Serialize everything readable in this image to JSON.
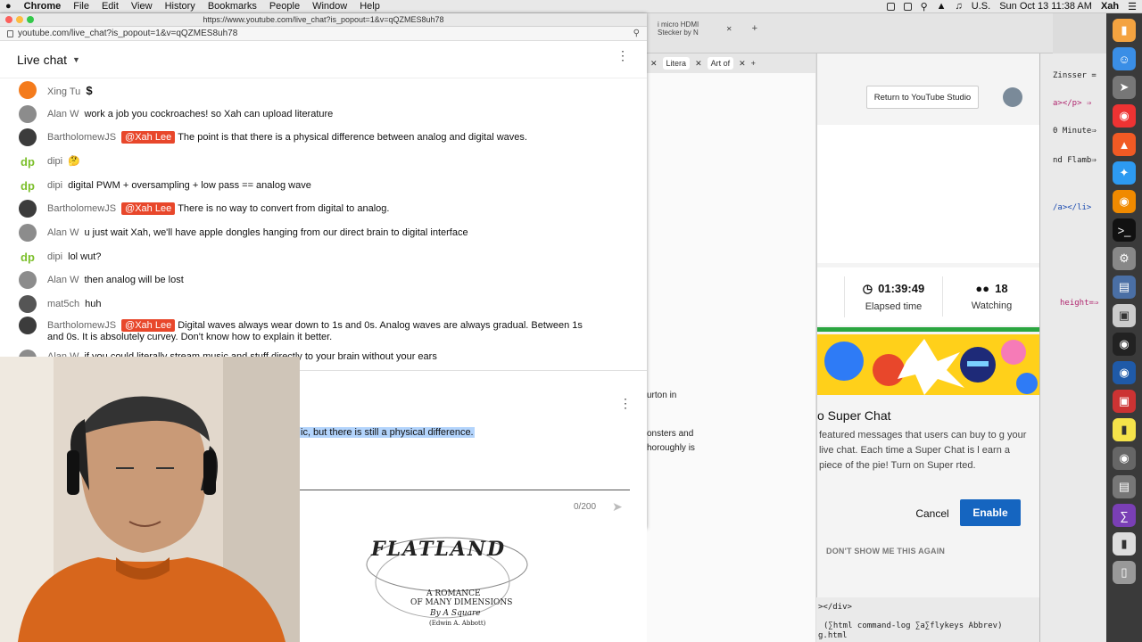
{
  "menubar": {
    "apple": "",
    "items": [
      "Chrome",
      "File",
      "Edit",
      "View",
      "History",
      "Bookmarks",
      "People",
      "Window",
      "Help"
    ],
    "right_region": "U.S.",
    "datetime": "Sun Oct 13  11:38 AM",
    "user": "Xah"
  },
  "popup": {
    "title_url": "https://www.youtube.com/live_chat?is_popout=1&v=qQZMES8uh78",
    "address": "youtube.com/live_chat?is_popout=1&v=qQZMES8uh78",
    "chat_title": "Live chat",
    "messages": [
      {
        "author": "Xing Tu",
        "mention": "",
        "text": "$"
      },
      {
        "author": "Alan W",
        "mention": "",
        "text": "work a job you cockroaches! so Xah can upload literature"
      },
      {
        "author": "BartholomewJS",
        "mention": "@Xah Lee",
        "text": "The point is that there is a physical difference between analog and digital waves."
      },
      {
        "author": "dipi",
        "mention": "",
        "text": "🤔"
      },
      {
        "author": "dipi",
        "mention": "",
        "text": "digital PWM + oversampling + low pass == analog wave"
      },
      {
        "author": "BartholomewJS",
        "mention": "@Xah Lee",
        "text": "There is no way to convert from digital to analog."
      },
      {
        "author": "Alan W",
        "mention": "",
        "text": "u just wait Xah, we'll have apple dongles hanging from our direct brain to digital interface"
      },
      {
        "author": "dipi",
        "mention": "",
        "text": "lol wut?"
      },
      {
        "author": "Alan W",
        "mention": "",
        "text": "then analog will be lost"
      },
      {
        "author": "mat5ch",
        "mention": "",
        "text": "huh"
      },
      {
        "author": "BartholomewJS",
        "mention": "@Xah Lee",
        "text": "Digital waves always wear down to 1s and 0s. Analog waves are always gradual. Between 1s and 0s. It is absolutely curvey. Don't know how to explain it better."
      },
      {
        "author": "Alan W",
        "mention": "",
        "text": "if you could literally stream music and stuff directly to your brain without your ears"
      }
    ],
    "highlighted_text": "ic, but there is still a physical difference.",
    "counter": "0/200"
  },
  "bg_tab": {
    "title": "i micro HDMI Stecker by N"
  },
  "win3": {
    "tabs": [
      "Litera",
      "Art of"
    ],
    "text1": "urton in",
    "text2": "onsters and",
    "text3": "horoughly is"
  },
  "studio": {
    "return_button": "Return to YouTube Studio",
    "elapsed_value": "01:39:49",
    "elapsed_label": "Elapsed time",
    "watching_value": "18",
    "watching_label": "Watching",
    "super_chat_title": "o Super Chat",
    "super_chat_desc": " featured messages that users can buy to g your live chat. Each time a Super Chat is l earn a piece of the pie! Turn on Super rted.",
    "cancel": "Cancel",
    "enable": "Enable",
    "dont_show": "DON'T SHOW ME THIS AGAIN"
  },
  "editor": {
    "lines": [
      "Zinsser =",
      "a></p> ⇒",
      "0 Minute⇒",
      "nd Flamb⇒",
      "/a></li>",
      "height=⇒"
    ],
    "bottom1": "></div>",
    "bottom2": "(∑html command-log ∑a∑flykeys Abbrev)",
    "bottom3": "g.html"
  },
  "book": {
    "title": "FLATLAND",
    "sub1": "A ROMANCE",
    "sub2": "OF MANY DIMENSIONS",
    "by": "By A Square",
    "author": "(Edwin A. Abbott)"
  },
  "colors": {
    "mention": "#e8472b",
    "enable": "#1565c0",
    "live_green": "#2ba640"
  }
}
